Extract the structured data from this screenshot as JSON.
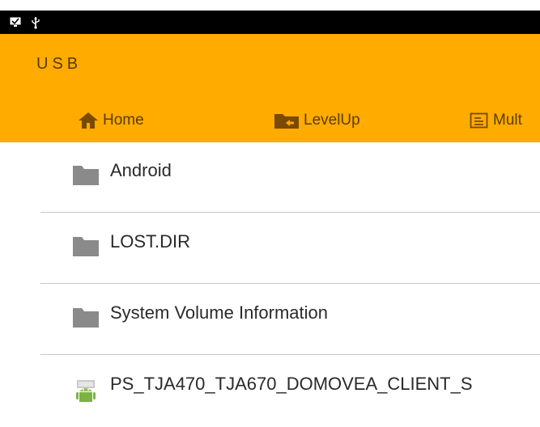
{
  "status_bar": {
    "icons": [
      "screen-check-icon",
      "usb-icon"
    ]
  },
  "app_bar": {
    "title": "USB",
    "toolbar": [
      {
        "label": "Home",
        "icon": "home-icon"
      },
      {
        "label": "LevelUp",
        "icon": "folder-up-icon"
      },
      {
        "label": "Mult",
        "icon": "multi-select-icon"
      }
    ]
  },
  "files": [
    {
      "name": "Android",
      "icon": "folder-icon"
    },
    {
      "name": "LOST.DIR",
      "icon": "folder-icon"
    },
    {
      "name": "System Volume Information",
      "icon": "folder-icon"
    },
    {
      "name": "PS_TJA470_TJA670_DOMOVEA_CLIENT_S",
      "icon": "android-apk-icon"
    }
  ],
  "colors": {
    "app_bar": "#ffab00",
    "toolbar_text": "#5b3e00",
    "folder": "#8a8a8a",
    "divider": "#c8c8c8"
  }
}
